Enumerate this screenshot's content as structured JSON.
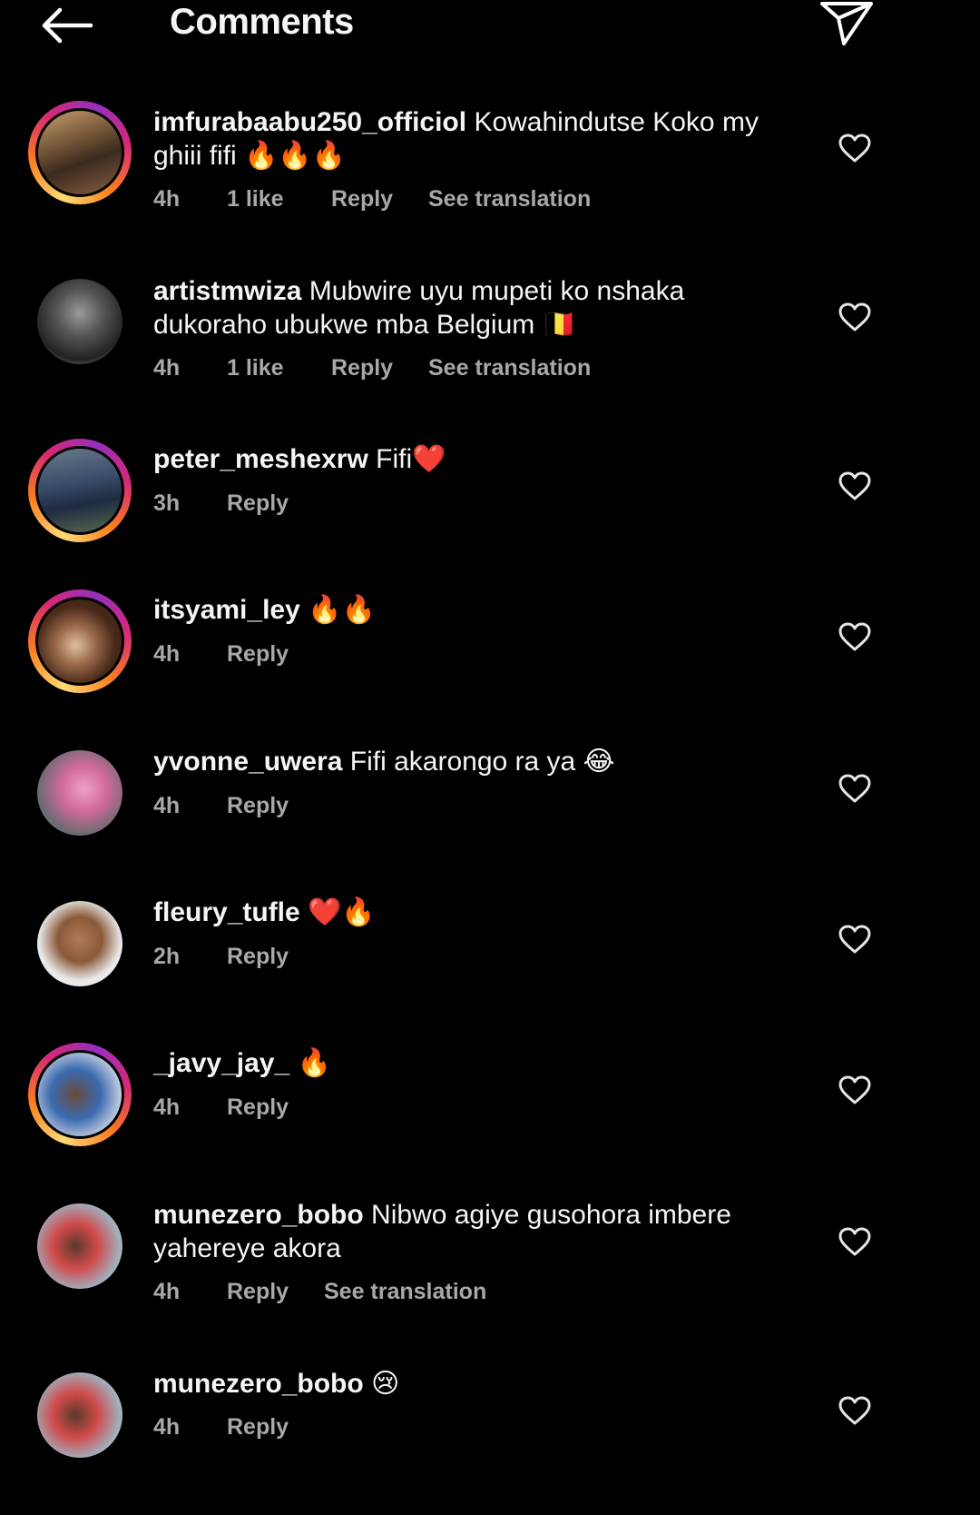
{
  "header": {
    "title": "Comments"
  },
  "comments": [
    {
      "username": "imfurabaabu250_officiol",
      "text": "Kowahindutse Koko my ghiii fifi 🔥🔥🔥",
      "time": "4h",
      "likes": "1 like",
      "reply": "Reply",
      "translate": "See translation"
    },
    {
      "username": "artistmwiza",
      "text": "Mubwire uyu mupeti ko nshaka dukoraho ubukwe mba Belgium 🇧🇪",
      "time": "4h",
      "likes": "1 like",
      "reply": "Reply",
      "translate": "See translation"
    },
    {
      "username": "peter_meshexrw",
      "text": "Fifi❤️",
      "time": "3h",
      "reply": "Reply"
    },
    {
      "username": "itsyami_ley",
      "text": "🔥🔥",
      "time": "4h",
      "reply": "Reply"
    },
    {
      "username": "yvonne_uwera",
      "text": "Fifi akarongo ra ya 😂",
      "time": "4h",
      "reply": "Reply"
    },
    {
      "username": "fleury_tufle",
      "text": "❤️🔥",
      "time": "2h",
      "reply": "Reply"
    },
    {
      "username": "_javy_jay_",
      "text": "🔥",
      "time": "4h",
      "reply": "Reply"
    },
    {
      "username": "munezero_bobo",
      "text": "Nibwo agiye gusohora imbere yahereye akora",
      "time": "4h",
      "reply": "Reply",
      "translate": "See translation"
    },
    {
      "username": "munezero_bobo",
      "text": "😢",
      "time": "4h",
      "reply": "Reply"
    }
  ],
  "icons": {
    "back": "arrow-left-icon",
    "send": "paper-plane-icon",
    "like": "heart-outline-icon"
  },
  "colors": {
    "background": "#000000",
    "text": "#f5f5f5",
    "secondary": "#a8a8a8"
  }
}
